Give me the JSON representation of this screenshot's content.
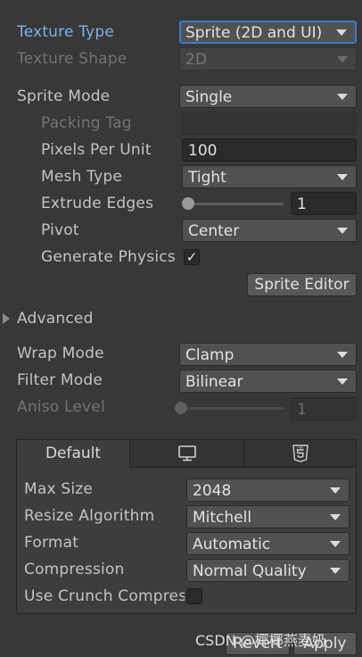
{
  "texture_type": {
    "label": "Texture Type",
    "value": "Sprite (2D and UI)"
  },
  "texture_shape": {
    "label": "Texture Shape",
    "value": "2D"
  },
  "sprite_mode": {
    "label": "Sprite Mode",
    "value": "Single"
  },
  "packing_tag": {
    "label": "Packing Tag",
    "value": ""
  },
  "pixels_per_unit": {
    "label": "Pixels Per Unit",
    "value": "100"
  },
  "mesh_type": {
    "label": "Mesh Type",
    "value": "Tight"
  },
  "extrude_edges": {
    "label": "Extrude Edges",
    "value": "1",
    "slider_fraction": 0.03
  },
  "pivot": {
    "label": "Pivot",
    "value": "Center"
  },
  "generate_physics": {
    "label": "Generate Physics",
    "checked": true,
    "check_glyph": "✓"
  },
  "sprite_editor": {
    "label": "Sprite Editor"
  },
  "advanced": {
    "label": "Advanced",
    "expanded": false
  },
  "wrap_mode": {
    "label": "Wrap Mode",
    "value": "Clamp"
  },
  "filter_mode": {
    "label": "Filter Mode",
    "value": "Bilinear"
  },
  "aniso_level": {
    "label": "Aniso Level",
    "value": "1",
    "slider_fraction": 0.0
  },
  "platform_tabs": {
    "default": "Default",
    "standalone_icon": "monitor-icon",
    "webgl_icon": "html5-icon",
    "html5_badge": "HTML"
  },
  "platform": {
    "max_size": {
      "label": "Max Size",
      "value": "2048"
    },
    "resize_algorithm": {
      "label": "Resize Algorithm",
      "value": "Mitchell"
    },
    "format": {
      "label": "Format",
      "value": "Automatic"
    },
    "compression": {
      "label": "Compression",
      "value": "Normal Quality"
    },
    "use_crunch": {
      "label": "Use Crunch Compres",
      "checked": false
    }
  },
  "footer": {
    "revert": "Revert",
    "apply": "Apply"
  },
  "watermark": "CSDN @椰椰燕麦奶",
  "colors": {
    "focus": "#3a78d0",
    "highlight_label": "#7fb0ee",
    "background": "#383838"
  }
}
